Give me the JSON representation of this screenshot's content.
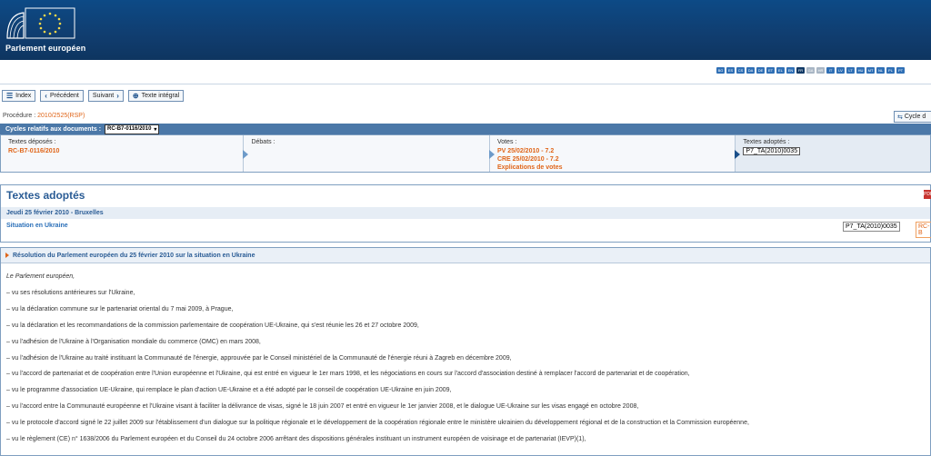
{
  "header": {
    "logo_text": "Parlement européen"
  },
  "languages": [
    {
      "code": "BG",
      "state": "normal"
    },
    {
      "code": "ES",
      "state": "normal"
    },
    {
      "code": "CS",
      "state": "normal"
    },
    {
      "code": "DA",
      "state": "normal"
    },
    {
      "code": "DE",
      "state": "normal"
    },
    {
      "code": "ET",
      "state": "normal"
    },
    {
      "code": "EL",
      "state": "normal"
    },
    {
      "code": "EN",
      "state": "normal"
    },
    {
      "code": "FR",
      "state": "active"
    },
    {
      "code": "GA",
      "state": "grey"
    },
    {
      "code": "HR",
      "state": "grey"
    },
    {
      "code": "IT",
      "state": "normal"
    },
    {
      "code": "LV",
      "state": "normal"
    },
    {
      "code": "LT",
      "state": "normal"
    },
    {
      "code": "HU",
      "state": "normal"
    },
    {
      "code": "MT",
      "state": "normal"
    },
    {
      "code": "NL",
      "state": "normal"
    },
    {
      "code": "PL",
      "state": "normal"
    },
    {
      "code": "PT",
      "state": "normal"
    }
  ],
  "toolbar": {
    "index_label": "Index",
    "prev_label": "Précédent",
    "next_label": "Suivant",
    "full_label": "Texte intégral"
  },
  "procedure": {
    "label": "Procédure :",
    "value": "2010/2525(RSP)"
  },
  "cycle_button": "Cycle d",
  "cycles_bar": {
    "label": "Cycles relatifs aux documents :",
    "selected": "RC-B7-0116/2010"
  },
  "cycles": {
    "deposes": {
      "title": "Textes déposés :",
      "value": "RC-B7-0116/2010"
    },
    "debats": {
      "title": "Débats :"
    },
    "votes": {
      "title": "Votes :",
      "lines": [
        "PV 25/02/2010 - 7.2",
        "CRE 25/02/2010 - 7.2",
        "Explications de votes"
      ]
    },
    "adoptes": {
      "title": "Textes adoptés :",
      "value": "P7_TA(2010)0035"
    }
  },
  "panel": {
    "title": "Textes adoptés",
    "date": "Jeudi 25 février 2010 - Bruxelles",
    "subject": "Situation en Ukraine",
    "ref": "P7_TA(2010)0035",
    "ref2": "RC-B"
  },
  "doc": {
    "title": "Résolution du Parlement européen du 25 février 2010 sur la situation en Ukraine",
    "intro": "Le Parlement européen,",
    "items": [
      "–  vu ses résolutions antérieures sur l'Ukraine,",
      "–  vu la déclaration commune sur le partenariat oriental du 7 mai 2009, à Prague,",
      "–  vu la déclaration et les recommandations de la commission parlementaire de coopération UE-Ukraine, qui s'est réunie les 26 et 27 octobre 2009,",
      "–  vu l'adhésion de l'Ukraine à l'Organisation mondiale du commerce (OMC) en mars 2008,",
      "–  vu l'adhésion de l'Ukraine au traité instituant la Communauté de l'énergie, approuvée par le Conseil ministériel de la Communauté de l'énergie réuni à Zagreb en décembre 2009,",
      "–  vu l'accord de partenariat et de coopération entre l'Union européenne et l'Ukraine, qui est entré en vigueur le 1er mars 1998, et les négociations en cours sur l'accord d'association destiné à remplacer l'accord de partenariat et de coopération,",
      "–  vu le programme d'association UE-Ukraine, qui remplace le plan d'action UE-Ukraine et a été adopté par le conseil de coopération UE-Ukraine en juin 2009,",
      "–  vu l'accord entre la Communauté européenne et l'Ukraine visant à faciliter la délivrance de visas, signé le 18 juin 2007 et entré en vigueur le 1er janvier 2008, et le dialogue UE-Ukraine sur les visas engagé en octobre 2008,",
      "–  vu le protocole d'accord signé le 22 juillet 2009 sur l'établissement d'un dialogue sur la politique régionale et le développement de la coopération régionale entre le ministère ukrainien du développement régional et de la construction et la Commission européenne,",
      "–  vu le règlement (CE) n° 1638/2006 du Parlement européen et du Conseil du 24 octobre 2006 arrêtant des dispositions générales instituant un instrument européen de voisinage et de partenariat (IEVP)(1),"
    ]
  }
}
